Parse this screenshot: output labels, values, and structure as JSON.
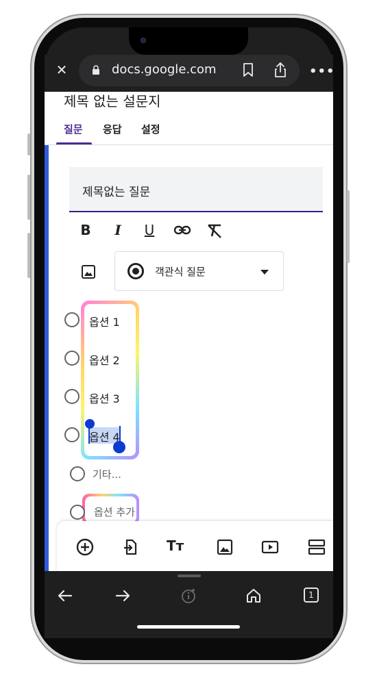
{
  "browser": {
    "url": "docs.google.com",
    "close_icon": "close-icon",
    "tab_count": "1"
  },
  "form": {
    "title": "제목 없는 설문지",
    "tabs": [
      {
        "label": "질문",
        "active": true
      },
      {
        "label": "응답",
        "active": false
      },
      {
        "label": "설정",
        "active": false
      }
    ],
    "question": {
      "title": "제목없는 질문",
      "type": "객관식 질문",
      "options": [
        "옵션 1",
        "옵션 2",
        "옵션 3",
        "옵션 4"
      ],
      "other": "기타...",
      "add_option": "옵션 추가"
    },
    "format": {
      "bold": "B",
      "italic": "I",
      "underline": "U"
    },
    "toolbar_tt": "Tт"
  },
  "colors": {
    "accent": "#4b2c92",
    "left_bar": "#2f5dd9",
    "selection": "#c7d8f5",
    "handle": "#0b3bd1"
  }
}
